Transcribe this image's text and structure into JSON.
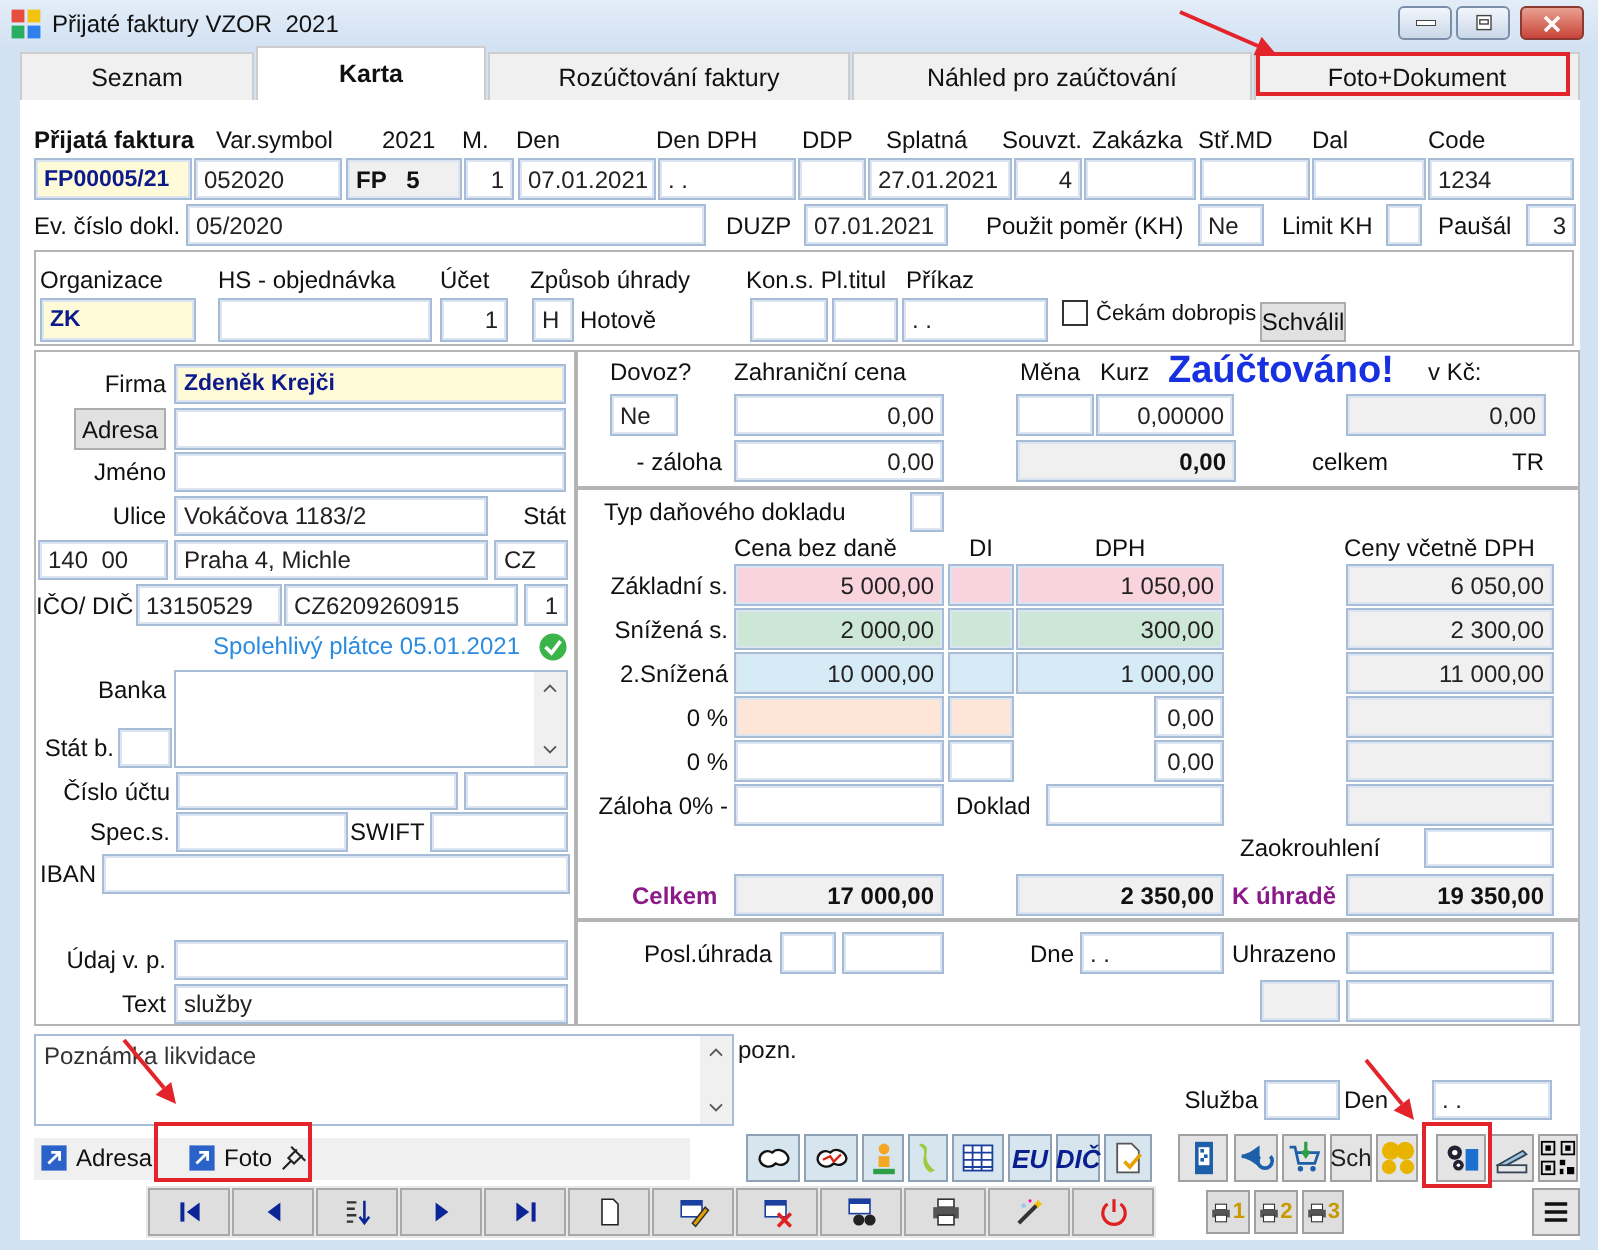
{
  "window": {
    "title": "Přijaté faktury VZOR  2021"
  },
  "tabs": [
    {
      "label": "Seznam",
      "selected": false
    },
    {
      "label": "Karta",
      "selected": true
    },
    {
      "label": "Rozúčtování faktury",
      "selected": false
    },
    {
      "label": "Náhled pro zaúčtování",
      "selected": false
    },
    {
      "label": "Foto+Dokument",
      "selected": false
    }
  ],
  "header": {
    "lines": [
      {
        "items": [
          {
            "kind": "heading",
            "text": "Přijatá faktura"
          },
          {
            "kind": "label",
            "text": "Var.symbol"
          },
          {
            "kind": "label",
            "text": "2021"
          },
          {
            "kind": "label",
            "text": "M."
          },
          {
            "kind": "label",
            "text": "Den"
          },
          {
            "kind": "label",
            "text": "Den DPH"
          },
          {
            "kind": "label",
            "text": "DDP"
          },
          {
            "kind": "label",
            "text": "Splatná"
          },
          {
            "kind": "label",
            "text": "Souvzt."
          },
          {
            "kind": "label",
            "text": "Zakázka"
          },
          {
            "kind": "label",
            "text": "Stř.MD"
          },
          {
            "kind": "label",
            "text": "Dal"
          },
          {
            "kind": "label",
            "text": "Code"
          }
        ]
      },
      {
        "items": [
          {
            "kind": "keyfield",
            "value": "FP00005/21"
          },
          {
            "kind": "field",
            "value": "052020"
          },
          {
            "kind": "docno",
            "value": "FP   5"
          },
          {
            "kind": "field",
            "value": "1"
          },
          {
            "kind": "field",
            "value": "07.01.2021"
          },
          {
            "kind": "field",
            "value": ". ."
          },
          {
            "kind": "field"
          },
          {
            "kind": "field",
            "value": "27.01.2021"
          },
          {
            "kind": "field",
            "value": "4"
          },
          {
            "kind": "field"
          },
          {
            "kind": "field"
          },
          {
            "kind": "field"
          },
          {
            "kind": "field",
            "value": "1234"
          }
        ]
      },
      {
        "items": [
          {
            "kind": "label",
            "text": "Ev. číslo dokl."
          },
          {
            "kind": "field",
            "value": "05/2020"
          },
          {
            "kind": "label",
            "text": "DUZP"
          },
          {
            "kind": "field",
            "value": "07.01.2021"
          },
          {
            "kind": "label",
            "text": "Použit poměr (KH)"
          },
          {
            "kind": "field",
            "value": "Ne"
          },
          {
            "kind": "label",
            "text": "Limit KH"
          },
          {
            "kind": "field"
          },
          {
            "kind": "label",
            "text": "Paušál"
          },
          {
            "kind": "field",
            "value": "3"
          }
        ]
      }
    ]
  },
  "organization": {
    "lines": [
      {
        "items": [
          {
            "kind": "label",
            "text": "Organizace"
          },
          {
            "kind": "label",
            "text": "HS - objednávka"
          },
          {
            "kind": "label",
            "text": "Účet"
          },
          {
            "kind": "label",
            "text": "Způsob úhrady"
          },
          {
            "kind": "label",
            "text": "Kon.s. Pl.titul"
          },
          {
            "kind": "label",
            "text": "Příkaz"
          }
        ]
      },
      {
        "items": [
          {
            "kind": "keyfield",
            "value": "ZK"
          },
          {
            "kind": "field"
          },
          {
            "kind": "field",
            "value": "1"
          },
          {
            "kind": "field",
            "value": "H"
          },
          {
            "kind": "label",
            "text": "Hotově"
          },
          {
            "kind": "field"
          },
          {
            "kind": "field"
          },
          {
            "kind": "field",
            "value": ". ."
          },
          {
            "kind": "checkbox",
            "text": "Čekám dobropis",
            "checked": false
          },
          {
            "kind": "button",
            "text": "Schválil"
          }
        ]
      }
    ]
  },
  "partner": {
    "lines": [
      {
        "items": [
          {
            "kind": "label",
            "text": "Firma"
          },
          {
            "kind": "keyfield",
            "value": "Zdeněk Krejči"
          }
        ]
      },
      {
        "items": [
          {
            "kind": "button",
            "text": "Adresa"
          },
          {
            "kind": "field"
          }
        ]
      },
      {
        "items": [
          {
            "kind": "label",
            "text": "Jméno"
          },
          {
            "kind": "field"
          }
        ]
      },
      {
        "items": [
          {
            "kind": "label",
            "text": "Ulice"
          },
          {
            "kind": "field",
            "value": "Vokáčova 1183/2"
          },
          {
            "kind": "label",
            "text": "Stát"
          }
        ]
      },
      {
        "items": [
          {
            "kind": "field",
            "value": "140  00"
          },
          {
            "kind": "field",
            "value": "Praha 4, Michle"
          },
          {
            "kind": "field",
            "value": "CZ"
          }
        ]
      },
      {
        "items": [
          {
            "kind": "label",
            "text": "IČO/ DIČ"
          },
          {
            "kind": "field",
            "value": "13150529"
          },
          {
            "kind": "field",
            "value": "CZ6209260915"
          },
          {
            "kind": "field",
            "value": "1"
          }
        ]
      },
      {
        "items": [
          {
            "kind": "status",
            "text": "Spolehlivý plátce 05.01.2021",
            "verified": true
          }
        ]
      },
      {
        "items": [
          {
            "kind": "label",
            "text": "Banka"
          },
          {
            "kind": "memo"
          }
        ]
      },
      {
        "items": [
          {
            "kind": "label",
            "text": "Stát b."
          },
          {
            "kind": "field"
          }
        ]
      },
      {
        "items": [
          {
            "kind": "label",
            "text": "Číslo účtu"
          },
          {
            "kind": "field"
          },
          {
            "kind": "field"
          }
        ]
      },
      {
        "items": [
          {
            "kind": "label",
            "text": "Spec.s."
          },
          {
            "kind": "field"
          },
          {
            "kind": "label",
            "text": "SWIFT"
          },
          {
            "kind": "field"
          }
        ]
      },
      {
        "items": [
          {
            "kind": "label",
            "text": "IBAN"
          },
          {
            "kind": "field"
          }
        ]
      },
      {
        "items": [
          {
            "kind": "label",
            "text": "Údaj v. p."
          },
          {
            "kind": "field"
          }
        ]
      },
      {
        "items": [
          {
            "kind": "label",
            "text": "Text"
          },
          {
            "kind": "field",
            "value": "služby"
          }
        ]
      }
    ]
  },
  "foreign": {
    "lines": [
      {
        "items": [
          {
            "kind": "label",
            "text": "Dovoz?"
          },
          {
            "kind": "label",
            "text": "Zahraniční cena"
          },
          {
            "kind": "label",
            "text": "Měna"
          },
          {
            "kind": "label",
            "text": "Kurz"
          },
          {
            "kind": "banner",
            "text": "Zaúčtováno!"
          },
          {
            "kind": "label",
            "text": "v Kč:"
          }
        ]
      },
      {
        "items": [
          {
            "kind": "field",
            "value": "Ne"
          },
          {
            "kind": "field",
            "value": "0,00"
          },
          {
            "kind": "field"
          },
          {
            "kind": "field",
            "value": "0,00000"
          },
          {
            "kind": "readonly",
            "value": "0,00"
          }
        ]
      },
      {
        "items": [
          {
            "kind": "label",
            "text": "- záloha"
          },
          {
            "kind": "field",
            "value": "0,00"
          },
          {
            "kind": "total",
            "value": "0,00"
          },
          {
            "kind": "label",
            "text": "celkem"
          },
          {
            "kind": "label",
            "text": "TR"
          }
        ]
      }
    ]
  },
  "vat": {
    "lines": [
      {
        "items": [
          {
            "kind": "label",
            "text": "Typ daňového dokladu"
          },
          {
            "kind": "field"
          }
        ]
      },
      {
        "items": [
          {
            "kind": "label",
            "text": "Cena bez daně"
          },
          {
            "kind": "label",
            "text": "DI"
          },
          {
            "kind": "label",
            "text": "DPH"
          },
          {
            "kind": "label",
            "text": "Ceny včetně DPH"
          }
        ]
      },
      {
        "items": [
          {
            "kind": "label",
            "text": "Základní s."
          },
          {
            "kind": "field",
            "value": "5 000,00",
            "color": "#f9d3dd"
          },
          {
            "kind": "field",
            "color": "#f9d3dd"
          },
          {
            "kind": "field",
            "value": "1 050,00",
            "color": "#f9d3dd"
          },
          {
            "kind": "readonly",
            "value": "6 050,00"
          }
        ]
      },
      {
        "items": [
          {
            "kind": "label",
            "text": "Snížená s."
          },
          {
            "kind": "field",
            "value": "2 000,00",
            "color": "#cde7d7"
          },
          {
            "kind": "field",
            "color": "#cde7d7"
          },
          {
            "kind": "field",
            "value": "300,00",
            "color": "#cde7d7"
          },
          {
            "kind": "readonly",
            "value": "2 300,00"
          }
        ]
      },
      {
        "items": [
          {
            "kind": "label",
            "text": "2.Snížená"
          },
          {
            "kind": "field",
            "value": "10 000,00",
            "color": "#d5ecf6"
          },
          {
            "kind": "field",
            "color": "#d5ecf6"
          },
          {
            "kind": "field",
            "value": "1 000,00",
            "color": "#d5ecf6"
          },
          {
            "kind": "readonly",
            "value": "11 000,00"
          }
        ]
      },
      {
        "items": [
          {
            "kind": "label",
            "text": "0 %"
          },
          {
            "kind": "field",
            "color": "#fde6d7"
          },
          {
            "kind": "field",
            "color": "#fde6d7"
          },
          {
            "kind": "field",
            "value": "0,00"
          },
          {
            "kind": "readonly"
          }
        ]
      },
      {
        "items": [
          {
            "kind": "label",
            "text": "0 %"
          },
          {
            "kind": "field"
          },
          {
            "kind": "field"
          },
          {
            "kind": "field",
            "value": "0,00"
          },
          {
            "kind": "readonly"
          }
        ]
      },
      {
        "items": [
          {
            "kind": "label",
            "text": "Záloha 0% -"
          },
          {
            "kind": "field"
          },
          {
            "kind": "label",
            "text": "Doklad"
          },
          {
            "kind": "field"
          },
          {
            "kind": "readonly"
          }
        ]
      },
      {
        "items": [
          {
            "kind": "label",
            "text": "Zaokrouhlení"
          },
          {
            "kind": "field"
          }
        ]
      },
      {
        "items": [
          {
            "kind": "accent",
            "text": "Celkem"
          },
          {
            "kind": "total",
            "value": "17 000,00"
          },
          {
            "kind": "total",
            "value": "2 350,00"
          },
          {
            "kind": "accent",
            "text": "K úhradě"
          },
          {
            "kind": "total",
            "value": "19 350,00"
          }
        ]
      }
    ]
  },
  "payment": {
    "lines": [
      {
        "items": [
          {
            "kind": "label",
            "text": "Posl.úhrada"
          },
          {
            "kind": "field"
          },
          {
            "kind": "field"
          },
          {
            "kind": "label",
            "text": "Dne"
          },
          {
            "kind": "field",
            "value": ". ."
          },
          {
            "kind": "label",
            "text": "Uhrazeno"
          },
          {
            "kind": "field"
          }
        ]
      },
      {
        "items": [
          {
            "kind": "readonly"
          },
          {
            "kind": "field"
          }
        ]
      }
    ]
  },
  "notes": {
    "lines": [
      {
        "items": [
          {
            "kind": "memo",
            "value": "Poznámka likvidace"
          },
          {
            "kind": "label",
            "text": "pozn."
          },
          {
            "kind": "label",
            "text": "Služba"
          },
          {
            "kind": "field"
          },
          {
            "kind": "label",
            "text": "Den"
          },
          {
            "kind": "field",
            "value": ". ."
          }
        ]
      }
    ]
  },
  "bottom_tabs": [
    {
      "label": "Adresa",
      "pinned": false
    },
    {
      "label": "Foto",
      "pinned": true
    }
  ],
  "tool_buttons": [
    {
      "kind": "icon"
    },
    {
      "kind": "icon"
    },
    {
      "kind": "icon"
    },
    {
      "kind": "icon"
    },
    {
      "kind": "icon"
    },
    {
      "kind": "text",
      "label": "EU"
    },
    {
      "kind": "text",
      "label": "DIČ"
    },
    {
      "kind": "icon"
    },
    {
      "kind": "icon"
    },
    {
      "kind": "icon"
    },
    {
      "kind": "icon"
    },
    {
      "kind": "text",
      "label": "Sch"
    },
    {
      "kind": "icon"
    },
    {
      "kind": "icon"
    },
    {
      "kind": "icon"
    },
    {
      "kind": "icon"
    }
  ],
  "print_buttons": [
    "1",
    "2",
    "3"
  ]
}
